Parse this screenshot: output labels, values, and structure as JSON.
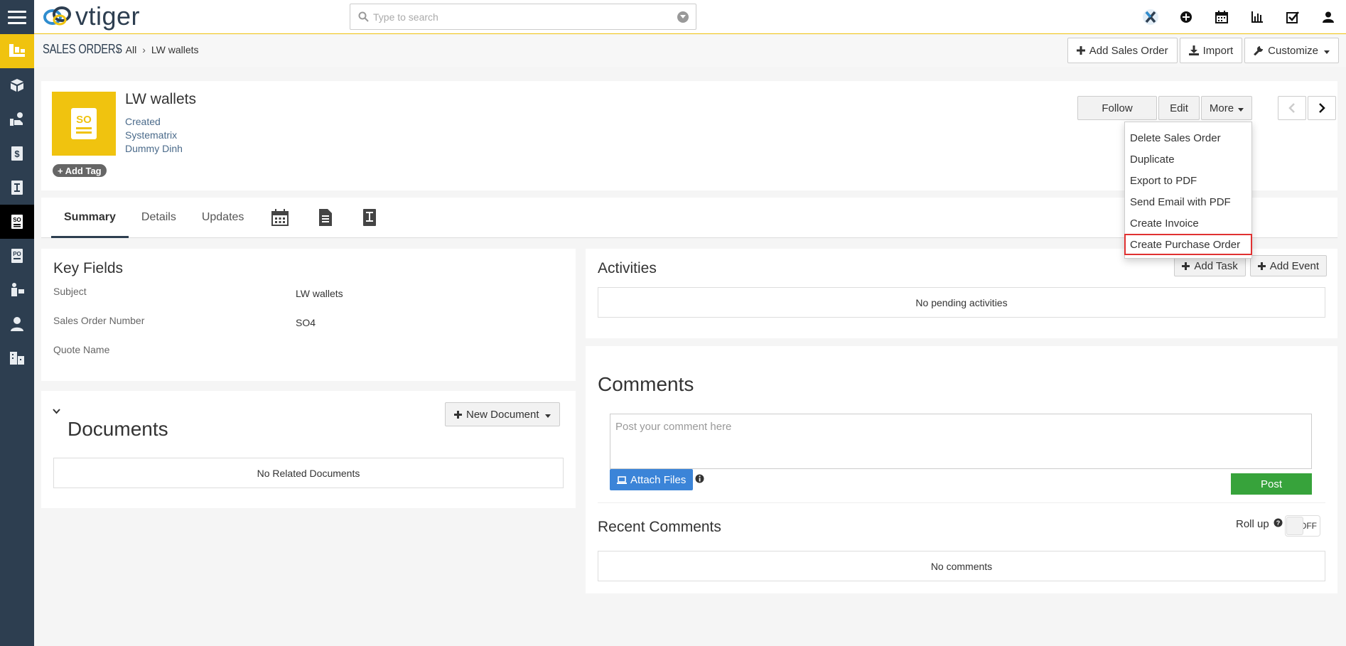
{
  "app": {
    "logo_text": "vtiger",
    "search_placeholder": "Type to search"
  },
  "header": {
    "module": "SALES ORDERS",
    "crumb_all": "All",
    "crumb_record": "LW wallets",
    "buttons": {
      "add": "Add Sales Order",
      "import": "Import",
      "customize": "Customize"
    }
  },
  "record": {
    "tile_label": "SO",
    "title": "LW wallets",
    "meta": [
      "Created",
      "Systematrix",
      "Dummy Dinh"
    ],
    "add_tag": "Add Tag",
    "actions": {
      "follow": "Follow",
      "edit": "Edit",
      "more": "More"
    }
  },
  "more_menu": {
    "items": [
      "Delete Sales Order",
      "Duplicate",
      "Export to PDF",
      "Send Email with PDF",
      "Create Invoice",
      "Create Purchase Order"
    ],
    "highlighted_index": 5
  },
  "tabs": [
    "Summary",
    "Details",
    "Updates"
  ],
  "key_fields": {
    "title": "Key Fields",
    "rows": [
      {
        "label": "Subject",
        "value": "LW wallets"
      },
      {
        "label": "Sales Order Number",
        "value": "SO4"
      },
      {
        "label": "Quote Name",
        "value": ""
      }
    ]
  },
  "documents": {
    "title": "Documents",
    "new_button": "New Document",
    "empty": "No Related Documents"
  },
  "activities": {
    "title": "Activities",
    "add_task": "Add Task",
    "add_event": "Add Event",
    "empty": "No pending activities"
  },
  "comments": {
    "title": "Comments",
    "placeholder": "Post your comment here",
    "attach": "Attach Files",
    "post": "Post",
    "recent_title": "Recent Comments",
    "rollup_label": "Roll up",
    "toggle_state": "OFF",
    "empty": "No comments"
  },
  "colors": {
    "brand_yellow": "#f0c30f",
    "rail": "#2d3e50",
    "post_green": "#37a33b",
    "attach_blue": "#3b84d8",
    "highlight_red": "#e03131"
  }
}
